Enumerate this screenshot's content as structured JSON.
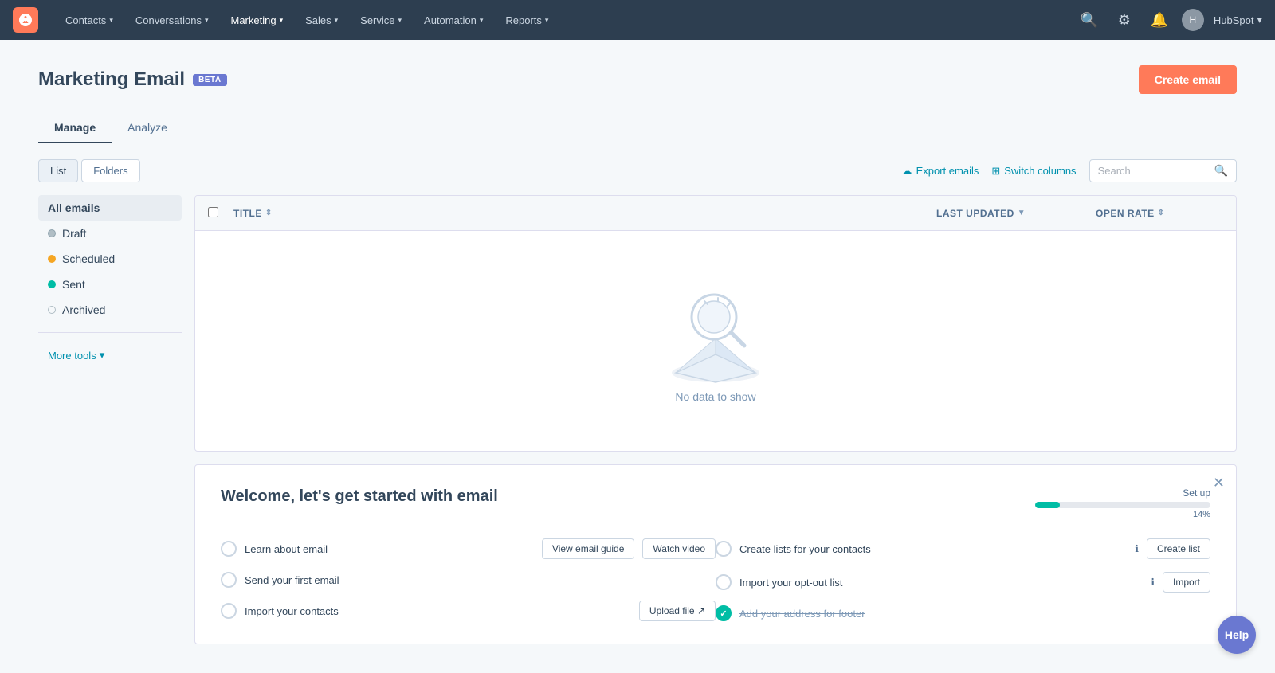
{
  "topnav": {
    "logo_alt": "HubSpot",
    "items": [
      {
        "label": "Contacts",
        "id": "contacts"
      },
      {
        "label": "Conversations",
        "id": "conversations"
      },
      {
        "label": "Marketing",
        "id": "marketing",
        "active": true
      },
      {
        "label": "Sales",
        "id": "sales"
      },
      {
        "label": "Service",
        "id": "service"
      },
      {
        "label": "Automation",
        "id": "automation"
      },
      {
        "label": "Reports",
        "id": "reports"
      }
    ],
    "account_name": "HubSpot"
  },
  "page": {
    "title": "Marketing Email",
    "beta_label": "BETA",
    "create_btn": "Create email"
  },
  "tabs": [
    {
      "label": "Manage",
      "active": true
    },
    {
      "label": "Analyze",
      "active": false
    }
  ],
  "toolbar": {
    "list_btn": "List",
    "folders_btn": "Folders",
    "export_label": "Export emails",
    "switch_columns_label": "Switch columns",
    "search_placeholder": "Search"
  },
  "sidebar": {
    "all_emails": "All emails",
    "items": [
      {
        "label": "Draft",
        "dot": "gray"
      },
      {
        "label": "Scheduled",
        "dot": "yellow"
      },
      {
        "label": "Sent",
        "dot": "green"
      },
      {
        "label": "Archived",
        "dot": "outline"
      }
    ],
    "more_tools": "More tools"
  },
  "table": {
    "col_title": "TITLE",
    "col_last_updated": "LAST UPDATED",
    "col_open_rate": "OPEN RATE",
    "empty_text": "No data to show"
  },
  "welcome": {
    "title": "Welcome, let's get started with email",
    "setup_label": "Set up",
    "setup_percent": "14%",
    "progress_value": 14,
    "tasks_left": [
      {
        "label": "Learn about email",
        "completed": false,
        "btn1": "View email guide",
        "btn2": "Watch video"
      },
      {
        "label": "Send your first email",
        "completed": false
      },
      {
        "label": "Import your contacts",
        "completed": false,
        "btn1": "Upload file"
      }
    ],
    "tasks_right": [
      {
        "label": "Create lists for your contacts",
        "completed": false,
        "btn1": "Create list",
        "has_info": true
      },
      {
        "label": "Import your opt-out list",
        "completed": false,
        "btn1": "Import",
        "has_info": true
      },
      {
        "label": "Add your address for footer",
        "completed": true,
        "strikethrough": true
      }
    ]
  },
  "help": {
    "label": "Help"
  }
}
